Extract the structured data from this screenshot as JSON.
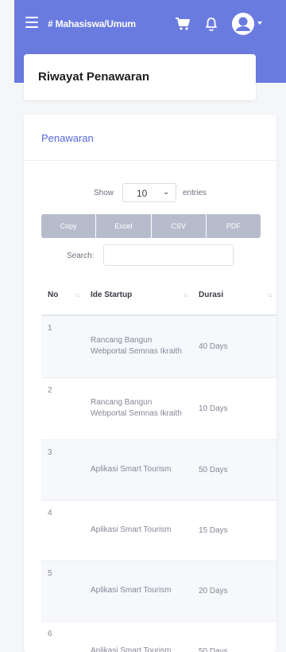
{
  "topbar": {
    "crumb": "# Mahasiswa/Umum",
    "icons": [
      "menu-icon",
      "cart-icon",
      "bell-icon",
      "user-avatar-icon",
      "caret-down-icon"
    ],
    "accent": "#6a7be0"
  },
  "page_title": "Riwayat Penawaran",
  "card": {
    "heading": "Penawaran",
    "length": {
      "show": "Show",
      "value": "10",
      "entries": "entries"
    },
    "buttons": [
      "Copy",
      "Excel",
      "CSV",
      "PDF"
    ],
    "search_label": "Search:",
    "search_value": "",
    "table": {
      "headers": [
        "No",
        "Ide Startup",
        "Durasi"
      ],
      "rows": [
        {
          "no": "1",
          "ide": "Rancang Bangun Webportal Semnas Ikraith",
          "durasi": "40 Days"
        },
        {
          "no": "2",
          "ide": "Rancang Bangun Webportal Semnas Ikraith",
          "durasi": "10 Days"
        },
        {
          "no": "3",
          "ide": "Aplikasi Smart Tourism",
          "durasi": "50 Days"
        },
        {
          "no": "4",
          "ide": "Aplikasi Smart Tourism",
          "durasi": "15 Days"
        },
        {
          "no": "5",
          "ide": "Aplikasi Smart Tourism",
          "durasi": "20 Days"
        },
        {
          "no": "6",
          "ide": "Aplikasi Smart Tourism",
          "durasi": "50 Days"
        }
      ]
    }
  }
}
